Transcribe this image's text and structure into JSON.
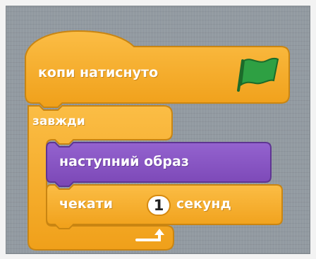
{
  "colors": {
    "event_block": "#f7ab22",
    "control_block": "#f5aa20",
    "looks_block": "#8a56c4",
    "flag": "#2ea043",
    "canvas": "#929aa1"
  },
  "script": {
    "hat": {
      "label": "копи натиснуто",
      "icon": "green-flag-icon"
    },
    "forever": {
      "label": "завжди",
      "loop_icon": "loop-arrow-icon"
    },
    "next_costume": {
      "label": "наступний образ"
    },
    "wait": {
      "label_before": "чекати",
      "value": "1",
      "label_after": "секунд"
    }
  }
}
